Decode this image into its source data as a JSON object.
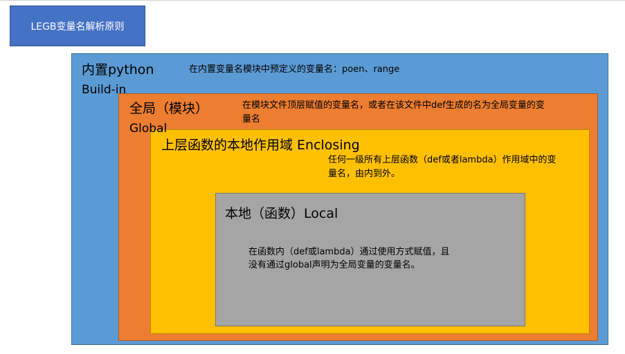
{
  "title": "LEGB变量名解析原则",
  "scopes": {
    "builtin": {
      "label": "内置python",
      "label_en": "Build-in",
      "description": "在内置变量名模块中预定义的变量名：poen、range",
      "color": "#5b9bd5"
    },
    "global": {
      "label": "全局（模块）",
      "label_en": "Global",
      "description": "在模块文件顶层赋值的变量名，或者在该文件中def生成的名为全局变量的变量名",
      "color": "#ed7d31"
    },
    "enclosing": {
      "label": "上层函数的本地作用域 Enclosing",
      "description": "任何一级所有上层函数（def或者lambda）作用域中的变量名，由内到外。",
      "color": "#ffc000"
    },
    "local": {
      "label": "本地（函数）Local",
      "description": "在函数内（def或lambda）通过使用方式赋值，且没有通过global声明为全局变量的变量名。",
      "color": "#a5a5a5"
    }
  }
}
